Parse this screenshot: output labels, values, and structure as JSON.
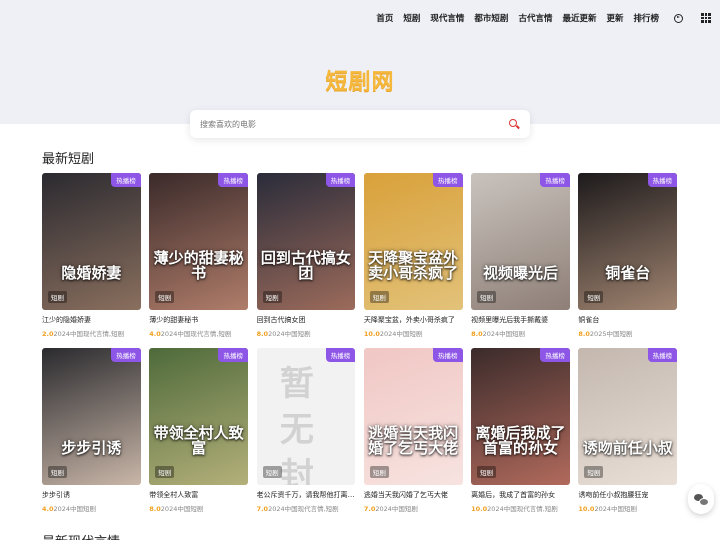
{
  "nav": {
    "items": [
      "首页",
      "短剧",
      "现代言情",
      "都市短剧",
      "古代言情",
      "最近更新",
      "更新",
      "排行榜"
    ],
    "icons": [
      "play-circle-icon",
      "grid-menu-icon"
    ]
  },
  "logo": {
    "text": "短剧网",
    "color": "#f5b83d"
  },
  "search": {
    "placeholder": "搜索喜欢的电影",
    "icon": "search-icon",
    "icon_color": "#dd3333"
  },
  "sections": [
    {
      "title": "最新短剧",
      "rows": [
        [
          {
            "title": "江少的隐婚娇妻",
            "score": "2.0",
            "meta": "2024中国现代言情,短剧",
            "badge": "热播榜",
            "type": "短剧",
            "caption": "隐婚娇妻"
          },
          {
            "title": "薄少的甜妻秘书",
            "score": "4.0",
            "meta": "2024中国现代言情,短剧",
            "badge": "热播榜",
            "type": "短剧",
            "caption": "薄少的甜妻秘书"
          },
          {
            "title": "回到古代搞女团",
            "score": "8.0",
            "meta": "2024中国短剧",
            "badge": "热播榜",
            "type": "短剧",
            "caption": "回到古代搞女团"
          },
          {
            "title": "天降聚宝盆，外卖小哥杀疯了",
            "score": "10.0",
            "meta": "2024中国短剧",
            "badge": "热播榜",
            "type": "短剧",
            "caption": "天降聚宝盆外卖小哥杀疯了"
          },
          {
            "title": "视频里曝光后我手撕戴婆",
            "score": "8.0",
            "meta": "2024中国短剧",
            "badge": "热播榜",
            "type": "短剧",
            "caption": "视频曝光后"
          },
          {
            "title": "铜雀台",
            "score": "8.0",
            "meta": "2025中国短剧",
            "badge": "热播榜",
            "type": "短剧",
            "caption": "铜雀台"
          }
        ],
        [
          {
            "title": "步步引诱",
            "score": "4.0",
            "meta": "2024中国短剧",
            "badge": "热播榜",
            "type": "短剧",
            "caption": "步步引诱"
          },
          {
            "title": "带领全村人致富",
            "score": "8.0",
            "meta": "2024中国短剧",
            "badge": "热播榜",
            "type": "短剧",
            "caption": "带领全村人致富"
          },
          {
            "title": "老公斥资千万，请我帮他打离婚官司",
            "score": "7.0",
            "meta": "2024中国现代言情,短剧",
            "badge": "热播榜",
            "type": "短剧",
            "caption": "",
            "no_image_text": "暂无封面"
          },
          {
            "title": "逃婚当天我闪婚了乞丐大佬",
            "score": "7.0",
            "meta": "2024中国短剧",
            "badge": "热播榜",
            "type": "短剧",
            "caption": "逃婚当天我闪婚了乞丐大佬"
          },
          {
            "title": "离婚后，我成了首富的孙女",
            "score": "10.0",
            "meta": "2024中国现代言情,短剧",
            "badge": "热播榜",
            "type": "短剧",
            "caption": "离婚后我成了首富的孙女"
          },
          {
            "title": "诱吻前任小叔抱腰狂宠",
            "score": "10.0",
            "meta": "2024中国短剧",
            "badge": "热播榜",
            "type": "短剧",
            "caption": "诱吻前任小叔"
          }
        ]
      ]
    },
    {
      "title": "最新现代言情",
      "rows": []
    }
  ],
  "poster_colors": [
    [
      "#2b2a30",
      "#8a6f5e"
    ],
    [
      "#3a2a2a",
      "#b07d6a"
    ],
    [
      "#2a2c3a",
      "#9c6b5b"
    ],
    [
      "#d9a13a",
      "#e2c27a"
    ],
    [
      "#c9c3bd",
      "#8e7f77"
    ],
    [
      "#1d1a1c",
      "#a08470"
    ],
    [
      "#2a2a2e",
      "#c9b6a8"
    ],
    [
      "#4e6a3a",
      "#b4b07a"
    ],
    [
      "#f2f2f2",
      "#f2f2f2"
    ],
    [
      "#f0c7c4",
      "#f7e3e0"
    ],
    [
      "#3b2b2b",
      "#b16a5c"
    ],
    [
      "#c3b7ae",
      "#e9dfd7"
    ]
  ],
  "floating": {
    "icon": "wechat-icon"
  }
}
